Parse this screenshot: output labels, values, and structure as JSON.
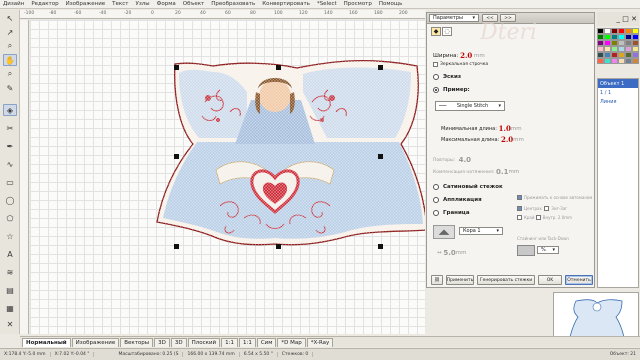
{
  "menu": [
    "Дизайн",
    "Редактор",
    "Изображение",
    "Текст",
    "Узлы",
    "Форма",
    "Объект",
    "Преобразовать",
    "Конвертировать",
    "*Select",
    "Просмотр",
    "Помощь"
  ],
  "ruler_ticks": [
    "-100",
    "-80",
    "-60",
    "-40",
    "-20",
    "0",
    "20",
    "40",
    "60",
    "80",
    "100",
    "120",
    "140",
    "160",
    "180",
    "200"
  ],
  "props": {
    "tab_params": "Параметры",
    "tab_arrows": "<<",
    "tab_next": ">>",
    "width_label": "Ширина:",
    "width_value": "2.0",
    "width_unit": "mm",
    "mirror_label": "Зеркальная строчка",
    "sketch_label": "Эскиз",
    "example_label": "Пример:",
    "stitch_type": "Single Stitch",
    "min_len_label": "Минимальная длина:",
    "min_len_value": "1.0",
    "min_len_unit": "mm",
    "max_len_label": "Максимальная длина:",
    "max_len_value": "2.0",
    "max_len_unit": "mm",
    "repeats_label": "Повторы:",
    "repeats_value": "4.0",
    "comp_label": "Компенсация натяжения:",
    "comp_value": "0.1",
    "comp_unit": "mm",
    "satin_label": "Сатиновый стежок",
    "applique_label": "Аппликация",
    "border_label": "Граница",
    "pattern_label": "Кора 1",
    "spacing_value": "5.0",
    "spacing_unit": "mm",
    "opt_auto": "Прижимать к основе автоманом",
    "opt_center": "Центрах",
    "opt_zigzag": "Зиг-Заг",
    "opt_edge": "Край",
    "opt_inner": "Внутр.",
    "opt_zig_value": "2.0",
    "opt_zig_unit": "mm",
    "opt_tack": "Стайнинг или Tack-Down",
    "percent": "%",
    "btn_apply": "Применить",
    "btn_generate": "Генерировать стежки",
    "btn_ok": "OK",
    "btn_cancel": "Отменить"
  },
  "side": {
    "title": "Объект 1",
    "item": "1 / 1",
    "item2": "Линия"
  },
  "bottom_tabs": [
    "Нормальный",
    "Изображение",
    "Векторы",
    "3D",
    "3D",
    "Плоский",
    "1:1",
    "1:1",
    "Сим",
    "*D Map",
    "*X-Ray"
  ],
  "status": [
    "X:178.4 Y:-5.0 mm",
    "X:7.02 Y:-0.04 \"",
    "Масштабировано: 0.25 (S",
    "166.00 x 139.74 mm",
    "6.54 x 5.50 \"",
    "Стежков: 0",
    "Объект: 21"
  ],
  "watermark": "Dteri"
}
